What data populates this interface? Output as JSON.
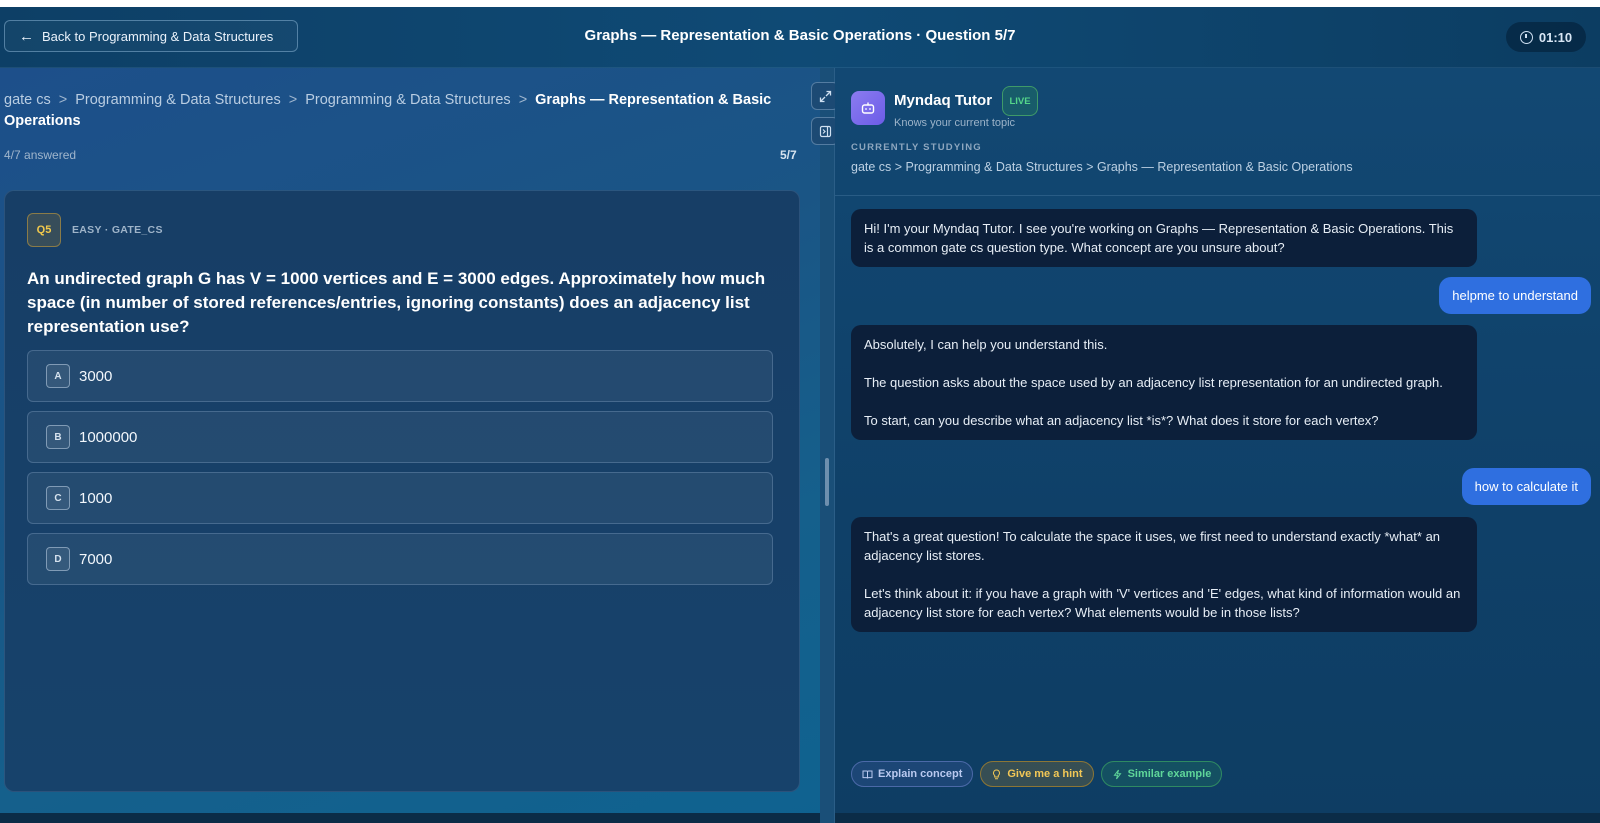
{
  "header": {
    "back_label": "Back to Programming & Data Structures",
    "title": "Graphs — Representation & Basic Operations · Question 5/7",
    "timer": "01:10"
  },
  "breadcrumb": {
    "items": [
      "gate cs",
      "Programming & Data Structures",
      "Programming & Data Structures"
    ],
    "separator": ">",
    "current": "Graphs — Representation & Basic Operations"
  },
  "progress": {
    "answered_text": "4/7 answered",
    "count": "5/7"
  },
  "question": {
    "badge": "Q5",
    "meta": "EASY · GATE_CS",
    "text": "An undirected graph G has V = 1000 vertices and E = 3000 edges. Approximately how much space (in number of stored references/entries, ignoring constants) does an adjacency list representation use?",
    "options": [
      {
        "letter": "A",
        "value": "3000"
      },
      {
        "letter": "B",
        "value": "1000000"
      },
      {
        "letter": "C",
        "value": "1000"
      },
      {
        "letter": "D",
        "value": "7000"
      }
    ]
  },
  "tutor": {
    "name": "Myndaq Tutor",
    "live": "LIVE",
    "subtitle": "Knows your current topic",
    "studying_label": "CURRENTLY STUDYING",
    "studying_path": "gate cs > Programming & Data Structures > Graphs — Representation & Basic Operations"
  },
  "chat": [
    {
      "role": "bot",
      "text": "Hi! I'm your Myndaq Tutor. I see you're working on Graphs — Representation & Basic Operations. This is a common gate cs question type. What concept are you unsure about?"
    },
    {
      "role": "user",
      "text": "helpme to understand"
    },
    {
      "role": "bot",
      "text": "Absolutely, I can help you understand this.\n\nThe question asks about the space used by an adjacency list representation for an undirected graph.\n\nTo start, can you describe what an adjacency list *is*? What does it store for each vertex?"
    },
    {
      "role": "user",
      "text": "how to calculate it"
    },
    {
      "role": "bot",
      "text": "That's a great question! To calculate the space it uses, we first need to understand exactly *what* an adjacency list stores.\n\nLet's think about it: if you have a graph with 'V' vertices and 'E' edges, what kind of information would an adjacency list store for each vertex? What elements would be in those lists?"
    }
  ],
  "chips": {
    "explain": "Explain concept",
    "hint": "Give me a hint",
    "similar": "Similar example"
  },
  "icons": {
    "back": "arrow-left-icon",
    "timer": "clock-icon",
    "expand": "expand-icon",
    "collapse_panel": "panel-collapse-icon",
    "bot": "robot-icon",
    "explain": "book-icon",
    "hint": "lightbulb-icon",
    "similar": "sparkle-icon"
  },
  "colors": {
    "accent_user_bubble": "#2f6fe0",
    "live_green": "#55d68a",
    "badge_gold": "#f2c94c"
  }
}
